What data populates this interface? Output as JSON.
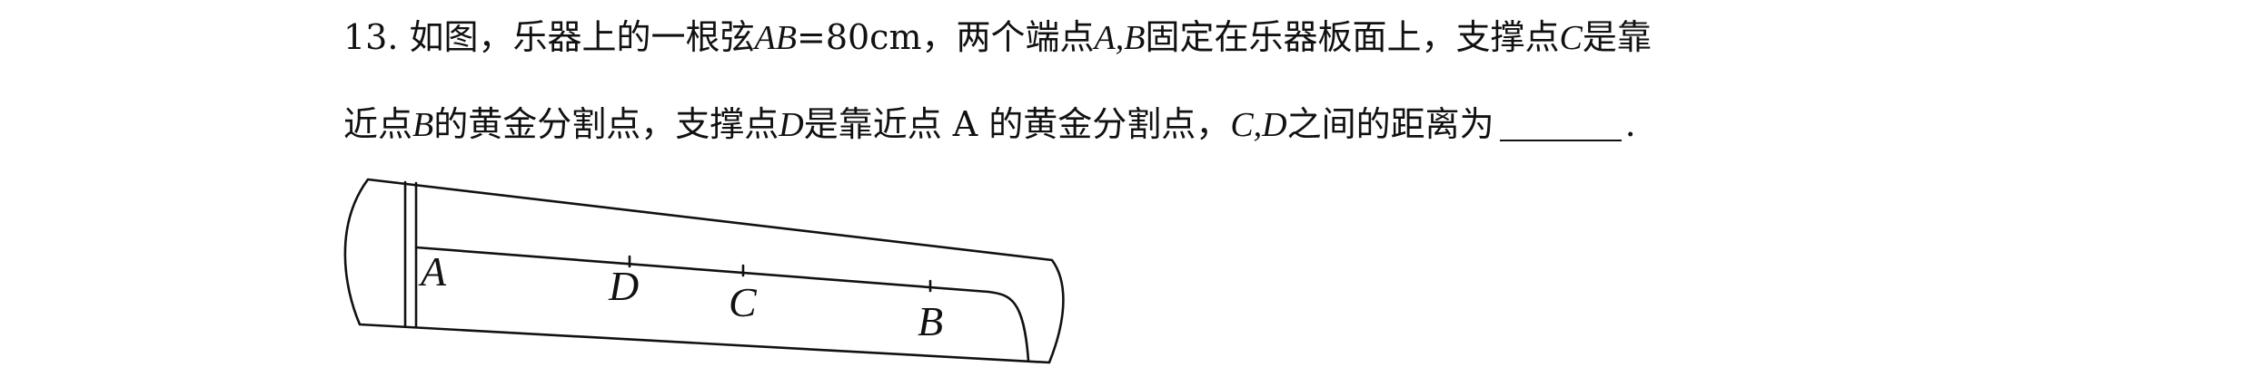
{
  "problem": {
    "number": "13.",
    "line1": {
      "t1": "如图，乐器上的一根弦",
      "m1": "AB",
      "t2": "=80cm，两个端点",
      "m2": "A,B",
      "t3": "固定在乐器板面上，支撑点",
      "m3": "C",
      "t4": "是靠"
    },
    "line2": {
      "t1": "近点",
      "m1": "B",
      "t2": "的黄金分割点，支撑点",
      "m2": "D",
      "t3": "是靠近点 A 的黄金分割点，",
      "m3": "C,D",
      "t4": "之间的距离为",
      "t5": "."
    }
  },
  "figure": {
    "labels": {
      "A": "A",
      "D": "D",
      "C": "C",
      "B": "B"
    }
  }
}
